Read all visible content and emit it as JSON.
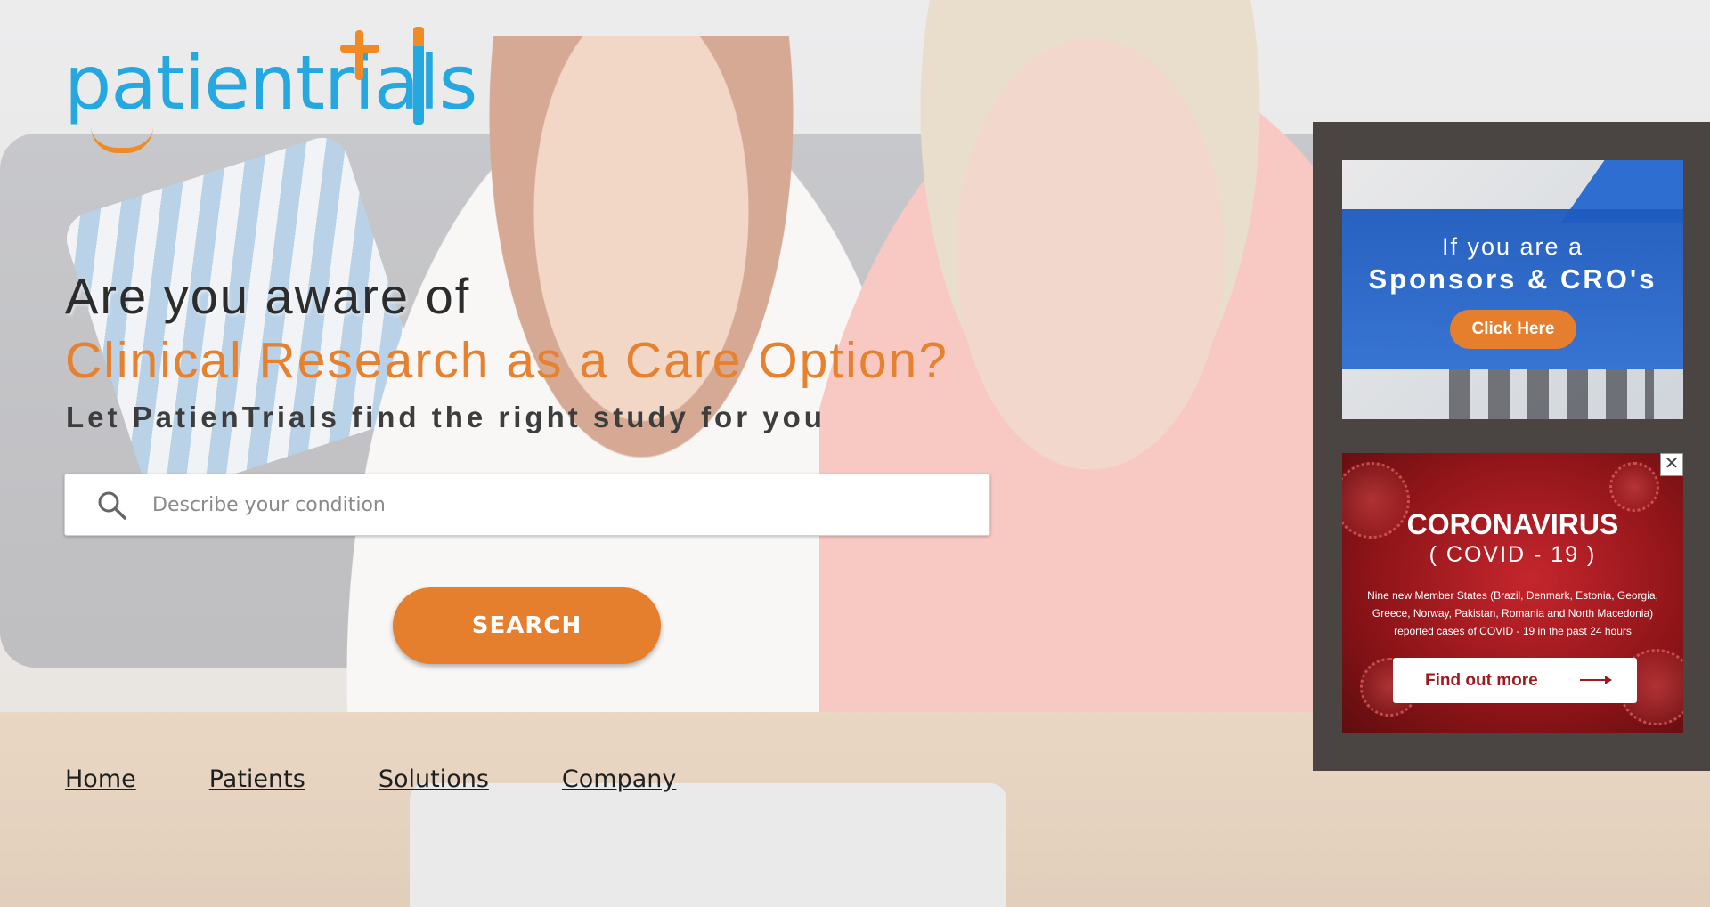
{
  "logo": {
    "text": "patientrials"
  },
  "hero": {
    "headline_line1": "Are you aware of",
    "headline_line2": "Clinical Research as a Care Option?",
    "subline": "Let PatienTrials find the right study for you"
  },
  "search": {
    "placeholder": "Describe your condition",
    "value": "",
    "button_label": "SEARCH"
  },
  "nav": {
    "items": [
      {
        "label": "Home"
      },
      {
        "label": "Patients"
      },
      {
        "label": "Solutions"
      },
      {
        "label": "Company"
      }
    ]
  },
  "ads": {
    "sponsors": {
      "line1": "If you are a",
      "line2": "Sponsors & CRO's",
      "button_label": "Click Here"
    },
    "covid": {
      "close_label": "✕",
      "title": "CORONAVIRUS",
      "subtitle": "( COVID - 19 )",
      "text": "Nine new Member States (Brazil, Denmark, Estonia, Georgia, Greece, Norway, Pakistan, Romania and North Macedonia) reported cases of COVID - 19 in the past 24 hours",
      "button_label": "Find out more"
    }
  },
  "colors": {
    "brand_blue": "#25a8df",
    "brand_orange": "#e57f2d",
    "ad_panel": "#4a4542",
    "covid_red": "#9d1a1f"
  },
  "icons": [
    "search-icon",
    "close-icon",
    "arrow-right-icon"
  ]
}
